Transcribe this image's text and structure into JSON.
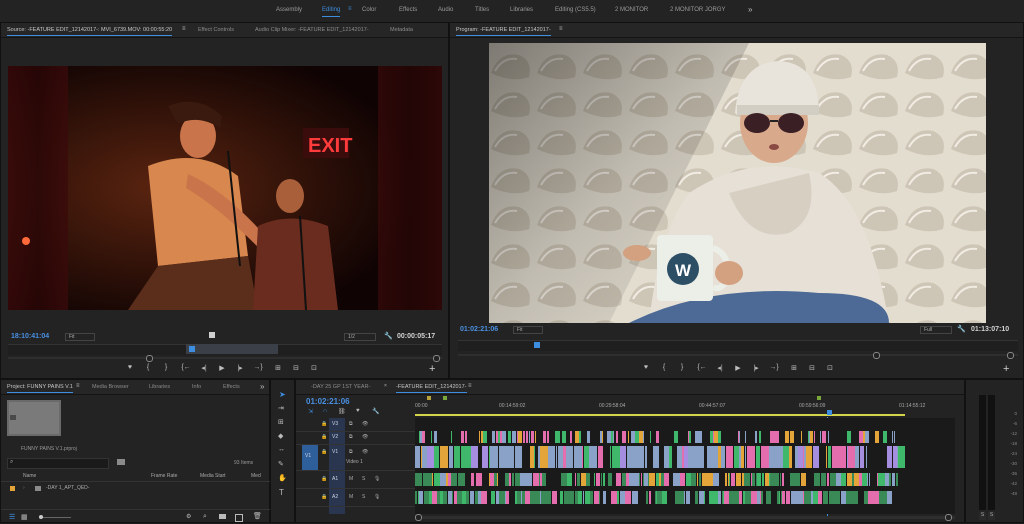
{
  "workspaces": [
    {
      "label": "Assembly",
      "active": false
    },
    {
      "label": "Editing",
      "active": true
    },
    {
      "label": "Color",
      "active": false
    },
    {
      "label": "Effects",
      "active": false
    },
    {
      "label": "Audio",
      "active": false
    },
    {
      "label": "Titles",
      "active": false
    },
    {
      "label": "Libraries",
      "active": false
    },
    {
      "label": "Editing (CS5.5)",
      "active": false
    },
    {
      "label": "2 MONITOR",
      "active": false
    },
    {
      "label": "2 MONITOR JORGY",
      "active": false
    }
  ],
  "workspace_menu_icon": "menu-icon",
  "workspace_more": "»",
  "source_panel": {
    "tabs": [
      "Source: -FEATURE EDIT_12142017-: MVI_6739.MOV: 00:00:55:20",
      "Effect Controls",
      "Audio Clip Mixer: -FEATURE EDIT_12142017-",
      "Metadata"
    ],
    "timecode_left": "18:10:41:04",
    "fit": "Fit",
    "resolution": "1/2",
    "timecode_right": "00:00:05:17"
  },
  "program_panel": {
    "tab": "Program: -FEATURE EDIT_12142017-",
    "timecode_left": "01:02:21:06",
    "fit": "Fit",
    "resolution": "Full",
    "timecode_right": "01:13:07:10"
  },
  "transport_glyphs": [
    "♥",
    "{",
    "}",
    "{←",
    "◂|",
    "▶",
    "|▸",
    "→}",
    "⊞",
    "⊟",
    "⊡"
  ],
  "project_panel": {
    "tabs": [
      "Project: FUNNY PAINS V.1",
      "Media Browser",
      "Libraries",
      "Info",
      "Effects"
    ],
    "more": "»",
    "file": "FUNNY PAINS V.1.prproj",
    "items_count": "93 Items",
    "columns": [
      "Name",
      "Frame Rate",
      "Media Start",
      "Med"
    ],
    "row": "-DAY 1_APT_QED-"
  },
  "timeline": {
    "tabs": [
      "-DAY 25 GP 1ST YEAR-",
      "-FEATURE EDIT_12142017-"
    ],
    "timecode": "01:02:21:06",
    "ruler_marks": [
      "00:00",
      "00:14:59:02",
      "00:29:58:04",
      "00:44:57:07",
      "00:59:56:09",
      "01:14:55:12"
    ],
    "tracks": [
      {
        "name": "V3",
        "label": ""
      },
      {
        "name": "V2",
        "label": ""
      },
      {
        "name": "V1",
        "label": "Video 1"
      },
      {
        "name": "A1",
        "label": ""
      },
      {
        "name": "A2",
        "label": ""
      }
    ],
    "track_source": "V1"
  },
  "audio_meter": {
    "ticks": [
      "0",
      "-6",
      "-12",
      "-18",
      "-24",
      "-30",
      "-36",
      "-42",
      "-48"
    ],
    "solo": [
      "S",
      "S"
    ]
  },
  "colors": {
    "accent": "#3d8ee0",
    "video_clip": "#8aa2c8",
    "pink_clip": "#e46dad",
    "orange_clip": "#e3a53a",
    "green_clip": "#3fb86b",
    "purple_clip": "#a58ee0",
    "audio_clip": "#3a8a58"
  }
}
